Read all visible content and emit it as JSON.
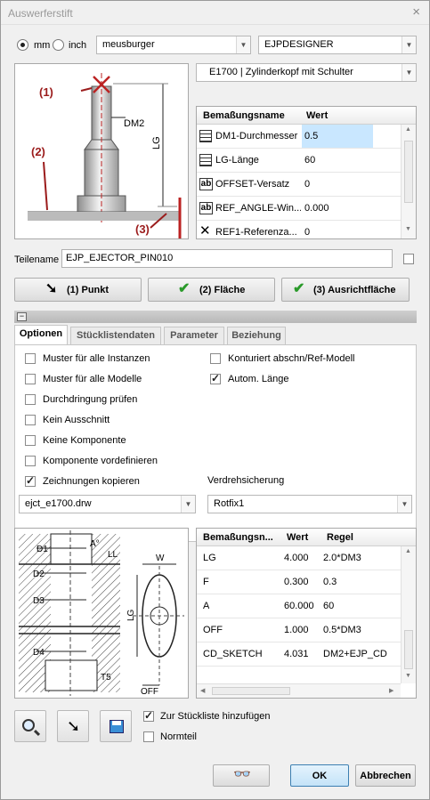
{
  "window": {
    "title": "Auswerferstift",
    "close": "×"
  },
  "units": {
    "mm": "mm",
    "inch": "inch",
    "selected": "mm"
  },
  "catalog": {
    "vendor": "meusburger",
    "designer": "EJPDESIGNER",
    "type": "E1700 | Zylinderkopf mit Schulter"
  },
  "preview_labels": {
    "p1": "(1)",
    "p2": "(2)",
    "p3": "(3)",
    "dm2": "DM2",
    "lg": "LG"
  },
  "dim_table": {
    "headers": [
      "Bemaßungsname",
      "Wert"
    ],
    "rows": [
      {
        "icon": "table-icon",
        "name": "DM1-Durchmesser",
        "value": "0.5"
      },
      {
        "icon": "table-icon",
        "name": "LG-Länge",
        "value": "60"
      },
      {
        "icon": "ab-icon",
        "name": "OFFSET-Versatz",
        "value": "0"
      },
      {
        "icon": "ab-icon",
        "name": "REF_ANGLE-Win...",
        "value": "0.000"
      },
      {
        "icon": "cross-icon",
        "name": "REF1-Referenza...",
        "value": "0"
      }
    ]
  },
  "part": {
    "label": "Teilename",
    "value": "EJP_EJECTOR_PIN010"
  },
  "actions": {
    "point": "(1) Punkt",
    "surface": "(2) Fläche",
    "align": "(3) Ausrichtfläche"
  },
  "tabs": [
    "Optionen",
    "Stücklistendaten",
    "Parameter",
    "Beziehung"
  ],
  "options": {
    "left": [
      {
        "label": "Muster für alle Instanzen",
        "checked": false
      },
      {
        "label": "Muster für alle Modelle",
        "checked": false
      },
      {
        "label": "Durchdringung prüfen",
        "checked": false
      },
      {
        "label": "Kein Ausschnitt",
        "checked": false
      },
      {
        "label": "Keine Komponente",
        "checked": false
      },
      {
        "label": "Komponente vordefinieren",
        "checked": false
      },
      {
        "label": "Zeichnungen kopieren",
        "checked": true
      }
    ],
    "right": [
      {
        "label": "Konturiert abschn/Ref-Modell",
        "checked": false
      },
      {
        "label": "Autom. Länge",
        "checked": true
      }
    ],
    "drawing": "ejct_e1700.drw",
    "anti_rotation_label": "Verdrehsicherung",
    "anti_rotation": "Rotfix1"
  },
  "sketch_labels": {
    "d1": "D1",
    "d2": "D2",
    "d3": "D3",
    "d4": "D4",
    "a": "A°",
    "ll": "LL",
    "t5": "T5",
    "w": "W",
    "lg": "LG",
    "off": "OFF"
  },
  "rule_table": {
    "headers": [
      "Bemaßungsn...",
      "Wert",
      "Regel"
    ],
    "rows": [
      {
        "name": "LG",
        "value": "4.000",
        "rule": "2.0*DM3"
      },
      {
        "name": "F",
        "value": "0.300",
        "rule": "0.3"
      },
      {
        "name": "A",
        "value": "60.000",
        "rule": "60"
      },
      {
        "name": "OFF",
        "value": "1.000",
        "rule": "0.5*DM3"
      },
      {
        "name": "CD_SKETCH",
        "value": "4.031",
        "rule": "DM2+EJP_CD"
      }
    ]
  },
  "bom": {
    "add": "Zur Stückliste hinzufügen",
    "add_checked": true,
    "std": "Normteil",
    "std_checked": false
  },
  "footer": {
    "ok": "OK",
    "cancel": "Abbrechen"
  },
  "colors": {
    "accent": "#c9e7ff",
    "marker": "#9b1c1c"
  }
}
